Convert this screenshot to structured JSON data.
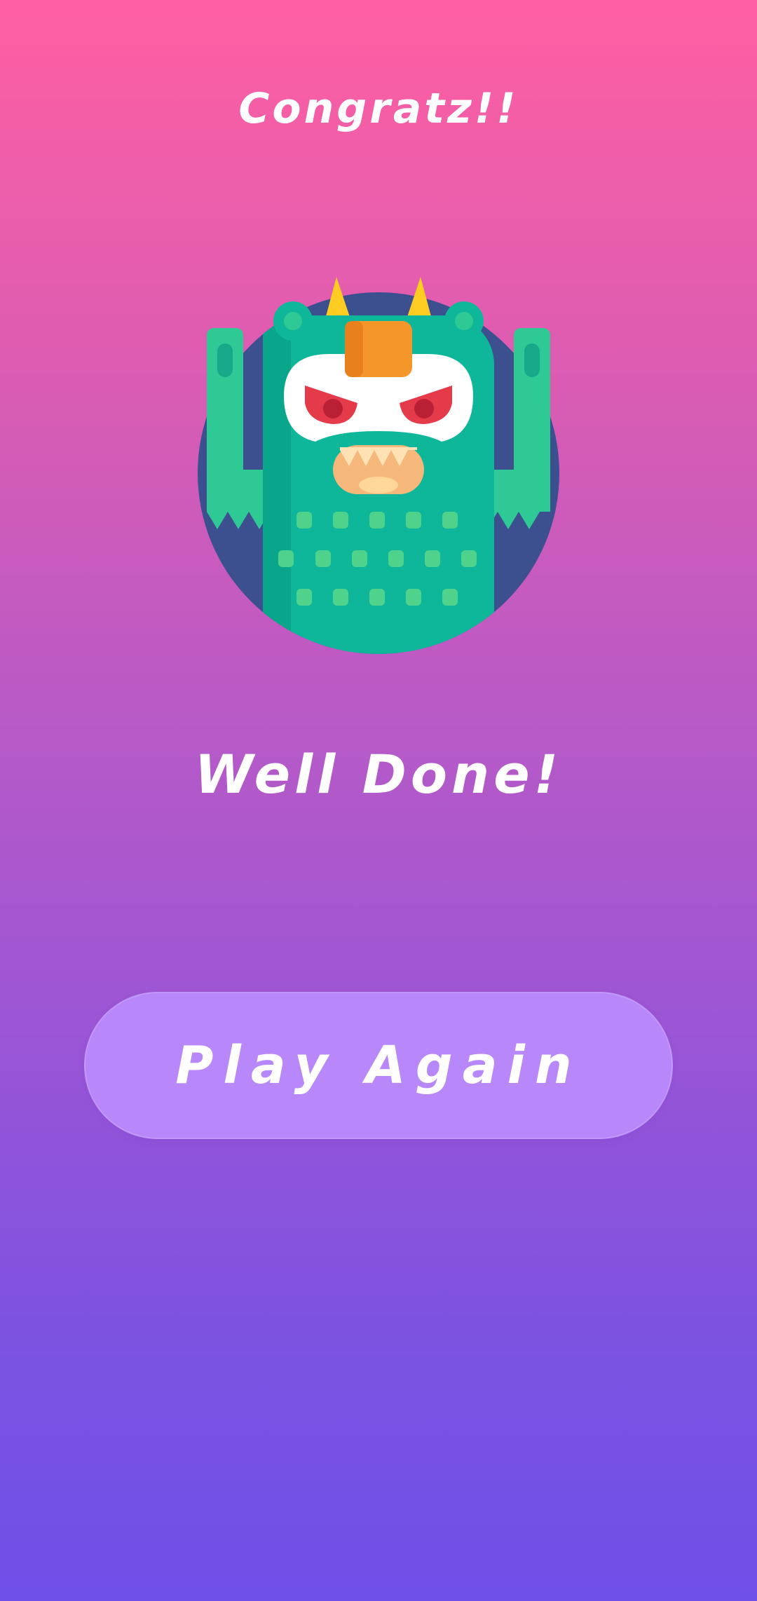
{
  "screen": {
    "title": "Congratz!!",
    "message": "Well Done!"
  },
  "actions": {
    "play_again_label": "Play Again"
  },
  "illustration": {
    "icon": "monster-icon",
    "colors": {
      "circle": "#3c4f8e",
      "body": "#0fb79a",
      "arms": "#2ec994",
      "horns": "#ffcc22",
      "hair": "#f5962a",
      "eyes": "#e53a4a"
    }
  },
  "colors": {
    "gradient_top": "#ff5fa2",
    "gradient_bottom": "#6f50e8",
    "button": "#b888fb",
    "text": "#ffffff"
  }
}
